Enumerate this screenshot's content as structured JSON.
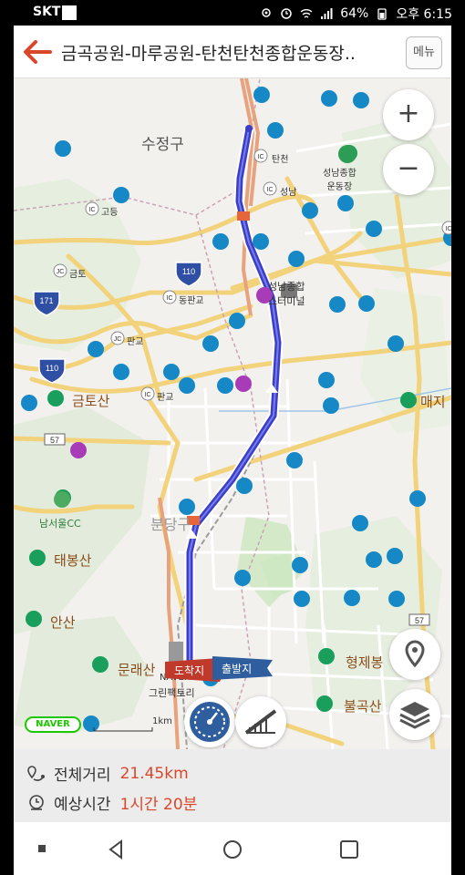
{
  "status_bar": {
    "carrier": "SKT",
    "battery": "64%",
    "time": "오후 6:15"
  },
  "header": {
    "title": "금곡공원-마루공원-탄천탄천종합운동장..",
    "menu_label": "메뉴"
  },
  "map": {
    "labels": {
      "district": "수정구",
      "sports_complex": "성남종합\n운동장",
      "terminal": "성남종합\n스터미널",
      "metro_tancheon": "탄천",
      "metro_seongnam": "성남",
      "ic_godeung": "고등",
      "jc_geumto": "금토",
      "ic_dongpangyo": "동판교",
      "jc_pangyo": "판교",
      "ic_pangyo": "판교",
      "mountain_geumto": "금토산",
      "mountain_maeji": "매지",
      "mountain_taebong": "태봉산",
      "mountain_an": "안산",
      "mountain_munrae": "문래산",
      "mountain_hyeongje": "형제봉",
      "mountain_bulgok": "불곡산",
      "golf": "남서울CC",
      "bundang": "분당구",
      "green_factory": "그린팩토리",
      "naver": "NAVER",
      "arrival_flag": "도착지",
      "departure_flag": "출발지",
      "scale": "1km",
      "road_110": "110",
      "road_171": "171",
      "road_57": "57"
    },
    "zoom_in": "+",
    "zoom_out": "−",
    "naver_logo": "NAVER"
  },
  "summary": {
    "distance_label": "전체거리",
    "distance_value": "21.45km",
    "time_label": "예상시간",
    "time_value": "1시간 20분"
  },
  "colors": {
    "route": "#3a3ec9",
    "accent": "#d9472b",
    "park": "#cfe8c4"
  }
}
